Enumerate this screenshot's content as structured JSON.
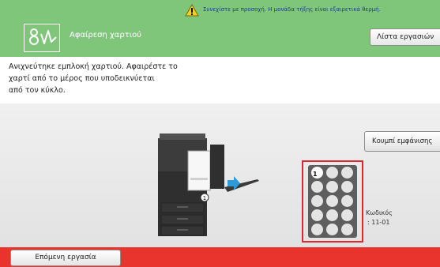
{
  "header": {
    "title": "Αφαίρεση χαρτιού",
    "warning": "Συνεχίστε με προσοχή. Η μονάδα τήξης είναι εξαιρετικά θερμή.",
    "job_list_label": "Λίστα εργασιών",
    "logo_icon": "error-logo-icon",
    "warning_icon": "warning-triangle-icon"
  },
  "message": {
    "line1": "Ανιχνεύτηκε εμπλοκή χαρτιού. Αφαιρέστε το",
    "line2": "χαρτί από το μέρος που υποδεικνύεται",
    "line3": "από τον κύκλο."
  },
  "main": {
    "display_button_label": "Κουμπί εμφάνισης",
    "printer_icon": "printer-icon",
    "jam_location_marker": "1",
    "code_label": "Κωδικός",
    "code_value": ": 11-01",
    "locator_marker": "1",
    "locator_active_position": 1,
    "locator_positions": 15
  },
  "footer": {
    "next_job_label": "Επόμενη εργασία"
  },
  "colors": {
    "header_bg": "#7fc67b",
    "footer_bg": "#e8342c",
    "highlight_red": "#e0282c",
    "arrow_blue": "#2e9bd8"
  }
}
